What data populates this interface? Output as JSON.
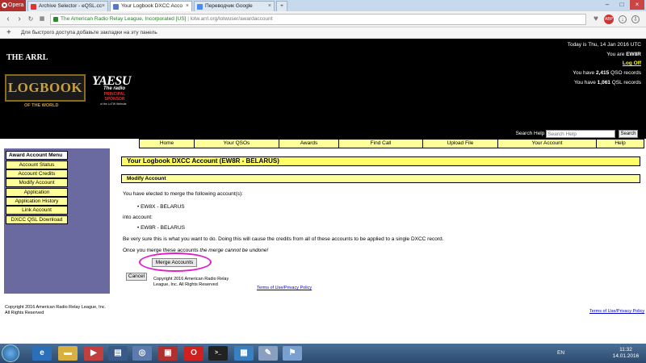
{
  "browser": {
    "app_name": "Opera",
    "tabs": [
      {
        "label": "Archive Selector - eQSL.cc",
        "active": false
      },
      {
        "label": "Your Logbook DXCC Acco",
        "active": true
      },
      {
        "label": "Переводчик Google",
        "active": false
      }
    ],
    "url_site": "The American Radio Relay League, Incorporated [US]",
    "url_path": "lotw.arrl.org/lotwuser/awardaccount",
    "bookmarks_hint": "Для быстрого доступа добавьте закладки на эту панель"
  },
  "header": {
    "logo_arrl": "THE ARRL",
    "logo_logbook": "LOGBOOK",
    "logo_world": "OF THE WORLD",
    "sponsor_name": "YAESU",
    "sponsor_tagline": "The radio",
    "sponsor_principal": "PRINCIPAL SPONSOR",
    "sponsor_small": "of the LoTW Website",
    "date_line": "Today is Thu, 14 Jan 2016 UTC",
    "you_are_prefix": "You are",
    "callsign": "EW8R",
    "logoff": "Log Off",
    "qso_line_prefix": "You have",
    "qso_count": "2,415",
    "qso_line_suffix": "QSO records",
    "qsl_line_prefix": "You have",
    "qsl_count": "1,061",
    "qsl_line_suffix": "QSL records",
    "search_label": "Search Help",
    "search_placeholder": "Search Help",
    "search_button": "Search"
  },
  "topnav": [
    "Home",
    "Your QSOs",
    "Awards",
    "Find Call",
    "Upload File",
    "Your Account",
    "Help"
  ],
  "sidebar": {
    "title": "Award Account Menu",
    "items": [
      "Account Status",
      "Account Credits",
      "Modify Account",
      "Application",
      "Application History",
      "Link Account",
      "DXCC QSL Download"
    ]
  },
  "main": {
    "title": "Your Logbook DXCC Account (EW8R - BELARUS)",
    "subtitle": "Modify Account",
    "intro": "You have elected to merge the following account(s):",
    "merge_from": "EW8X - BELARUS",
    "into_label": "into account:",
    "merge_into": "EW8R - BELARUS",
    "warning": "Be very sure this is what you want to do. Doing this will cause the credits from all of these accounts to be applied to a single DXCC record.",
    "once_prefix": "Once you merge these accounts",
    "once_italic": "the merge cannot be undone!",
    "merge_button": "Merge Accounts",
    "cancel_button": "Cancel",
    "inner_copyright": "Copyright 2016 American Radio Relay League, Inc. All Rights Reserved",
    "inner_terms": "Terms of Use/Privacy Policy"
  },
  "footer": {
    "copyright": "Copyright 2016 American Radio Relay League, Inc. All Rights Reserved",
    "terms": "Terms of Use/Privacy Policy"
  },
  "taskbar": {
    "lang": "EN",
    "time": "11:32",
    "date": "14.01.2016"
  },
  "colors": {
    "nav_yellow": "#ffff99",
    "title_yellow": "#ffff66",
    "sidebar_purple": "#6a6aa0",
    "highlight_magenta": "#e01ec8"
  }
}
